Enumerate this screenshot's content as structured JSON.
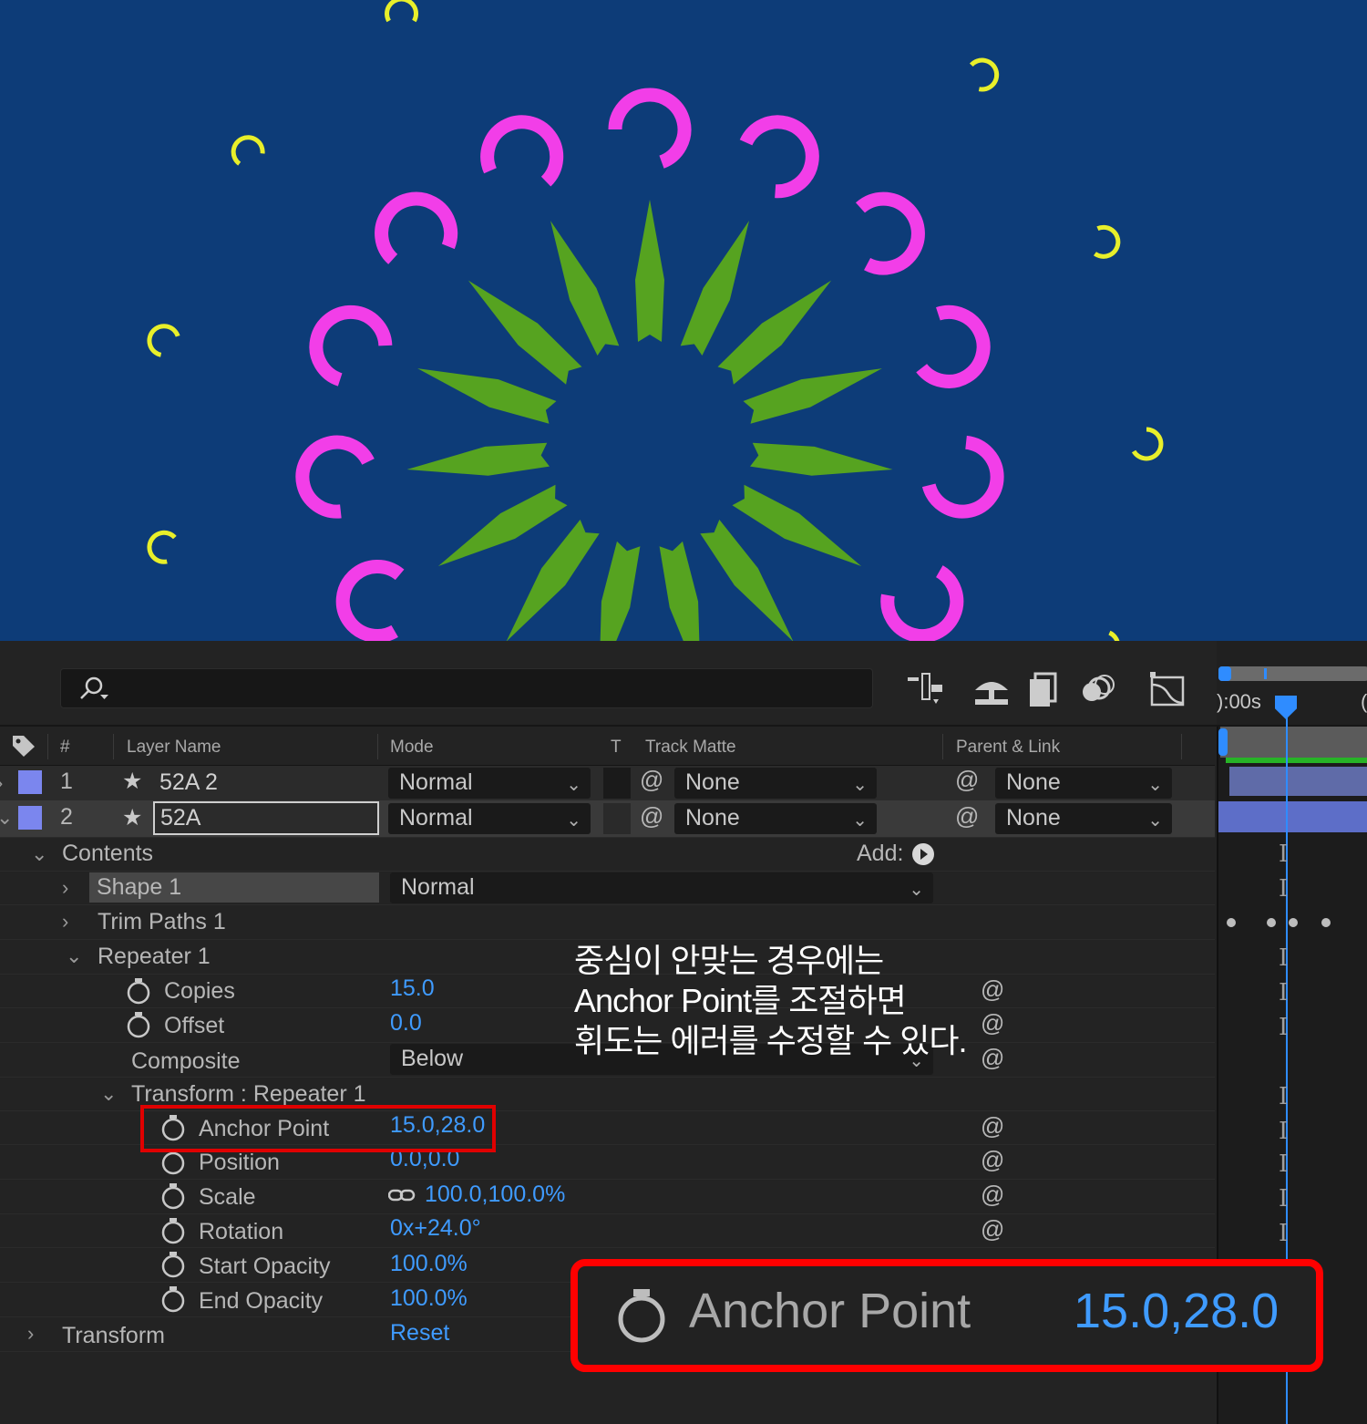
{
  "toolbar": {
    "search_placeholder": ""
  },
  "timeline": {
    "time_label": "):00s"
  },
  "columns": {
    "num": "#",
    "layer_name": "Layer Name",
    "mode": "Mode",
    "t": "T",
    "track_matte": "Track Matte",
    "parent": "Parent & Link"
  },
  "layers": [
    {
      "num": "1",
      "name": "52A 2",
      "mode": "Normal",
      "matte": "None",
      "parent": "None"
    },
    {
      "num": "2",
      "name": "52A",
      "mode": "Normal",
      "matte": "None",
      "parent": "None"
    }
  ],
  "contents": {
    "label": "Contents",
    "add_label": "Add:",
    "shape": {
      "label": "Shape 1",
      "mode": "Normal"
    },
    "trim": "Trim Paths 1",
    "repeater": {
      "label": "Repeater 1",
      "copies_label": "Copies",
      "copies": "15.0",
      "offset_label": "Offset",
      "offset": "0.0",
      "composite_label": "Composite",
      "composite": "Below",
      "transform_label": "Transform : Repeater 1",
      "anchor_label": "Anchor Point",
      "anchor": "15.0,28.0",
      "position_label": "Position",
      "position": "0.0,0.0",
      "scale_label": "Scale",
      "scale": "100.0,100.0%",
      "rotation_label": "Rotation",
      "rotation": "0x+24.0°",
      "start_opacity_label": "Start Opacity",
      "start_opacity": "100.0%",
      "end_opacity_label": "End Opacity",
      "end_opacity": "100.0%"
    }
  },
  "transform": {
    "label": "Transform",
    "reset": "Reset"
  },
  "annotation": {
    "line1": "중심이 안맞는 경우에는",
    "line2": "Anchor Point를 조절하면",
    "line3": "휘도는  에러를 수정할 수 있다."
  },
  "zoom": {
    "label": "Anchor Point",
    "value": "15.0,28.0"
  },
  "colors": {
    "background": "#0d3c78",
    "magenta": "#f23ee8",
    "green": "#56a320",
    "yellow": "#e8ef2a",
    "accent": "#3f9bff",
    "highlight": "#e00000"
  }
}
